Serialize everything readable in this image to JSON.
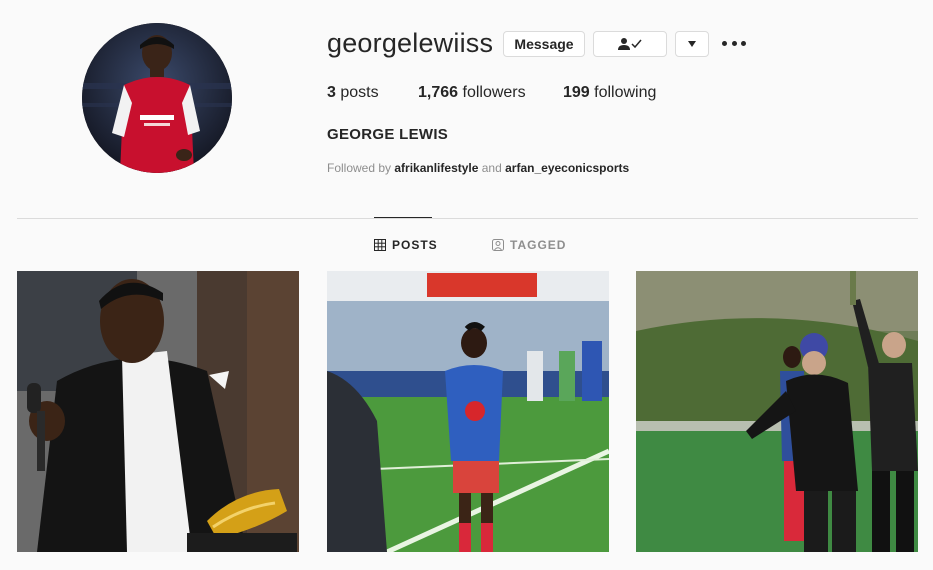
{
  "profile": {
    "username": "georgelewiiss",
    "full_name": "GEORGE LEWIS",
    "avatar_icon": "profile-photo",
    "followed_by_prefix": "Followed by ",
    "followed_by_user1": "afrikanlifestyle",
    "followed_by_and": " and ",
    "followed_by_user2": "arfan_eyeconicsports"
  },
  "buttons": {
    "message": "Message",
    "follow_icon": "person-check-icon",
    "dropdown_icon": "caret-down-icon",
    "more_icon": "ellipsis-icon"
  },
  "stats": {
    "posts_count": "3",
    "posts_label": " posts",
    "followers_count": "1,766",
    "followers_label": " followers",
    "following_count": "199",
    "following_label": " following"
  },
  "tabs": [
    {
      "label": "POSTS",
      "icon": "grid-icon",
      "active": true
    },
    {
      "label": "TAGGED",
      "icon": "tag-user-icon",
      "active": false
    }
  ],
  "posts": [
    {
      "icon": "photo-award-speech"
    },
    {
      "icon": "photo-football-pitch"
    },
    {
      "icon": "photo-sideline"
    }
  ],
  "colors": {
    "background": "#fafafa",
    "text": "#262626",
    "muted": "#8e8e8e",
    "border": "#dbdbdb"
  }
}
